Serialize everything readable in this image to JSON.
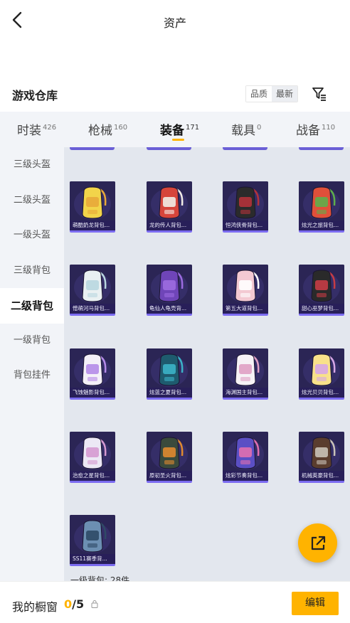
{
  "header": {
    "title": "资产"
  },
  "section": {
    "title": "游戏仓库",
    "sort_options": [
      "品质",
      "最新"
    ],
    "active_sort": 1
  },
  "tabs": [
    {
      "label": "时装",
      "count": "426"
    },
    {
      "label": "枪械",
      "count": "160"
    },
    {
      "label": "装备",
      "count": "171"
    },
    {
      "label": "载具",
      "count": "0"
    },
    {
      "label": "战备",
      "count": "110"
    }
  ],
  "sidebar": {
    "items": [
      "三级头盔",
      "二级头盔",
      "一级头盔",
      "三级背包",
      "二级背包",
      "一级背包",
      "背包挂件"
    ]
  },
  "items": [
    {
      "name": "萌酷奶龙背包...",
      "colors": [
        "#f2d44a",
        "#e8a93a"
      ]
    },
    {
      "name": "龙的传人背包...",
      "colors": [
        "#d6453b",
        "#f1ece6"
      ]
    },
    {
      "name": "恒鸿侠骨背包...",
      "colors": [
        "#2b2b2b",
        "#b3323a"
      ]
    },
    {
      "name": "炫光之旅背包...",
      "colors": [
        "#e0503a",
        "#5fae4b"
      ]
    },
    {
      "name": "憎萌河马背包...",
      "colors": [
        "#e9f0f2",
        "#b9d7e0"
      ]
    },
    {
      "name": "龟仙人龟壳背...",
      "colors": [
        "#6f45b8",
        "#9c6be0"
      ]
    },
    {
      "name": "第五大道背包...",
      "colors": [
        "#f3c9d2",
        "#ffffff"
      ]
    },
    {
      "name": "甜心巫梦背包...",
      "colors": [
        "#2a2a2a",
        "#c63c45"
      ]
    },
    {
      "name": "飞蚀魅影背包...",
      "colors": [
        "#f4f0f8",
        "#b58be8"
      ]
    },
    {
      "name": "炫蓝之夏背包...",
      "colors": [
        "#1e5b6e",
        "#3bb2c7"
      ]
    },
    {
      "name": "海渊国主背包...",
      "colors": [
        "#f6f2f6",
        "#e0a0c4"
      ]
    },
    {
      "name": "炫光贝贝背包...",
      "colors": [
        "#f8e18a",
        "#d6a7e6"
      ]
    },
    {
      "name": "治愈之星背包...",
      "colors": [
        "#ece8f5",
        "#d69ad1"
      ]
    },
    {
      "name": "原初圣火背包...",
      "colors": [
        "#3a4a3c",
        "#e08a2f"
      ]
    },
    {
      "name": "炫彩节奏背包...",
      "colors": [
        "#5b4fc4",
        "#e06fb0"
      ]
    },
    {
      "name": "机械英豪背包...",
      "colors": [
        "#5a3d2e",
        "#c9c2b7"
      ]
    },
    {
      "name": "SS11赛季背...",
      "colors": [
        "#6c8fb2",
        "#2f4a66"
      ]
    }
  ],
  "grid_footer": "一级背包: 28件",
  "bottom_bar": {
    "label": "我的橱窗",
    "current": "0",
    "total": "/5",
    "edit_label": "编辑"
  },
  "colors": {
    "accent": "#ffb300",
    "card_bg": "#2b2555",
    "card_border": "#7b6bf0",
    "panel_bg": "#f2f4f8"
  }
}
